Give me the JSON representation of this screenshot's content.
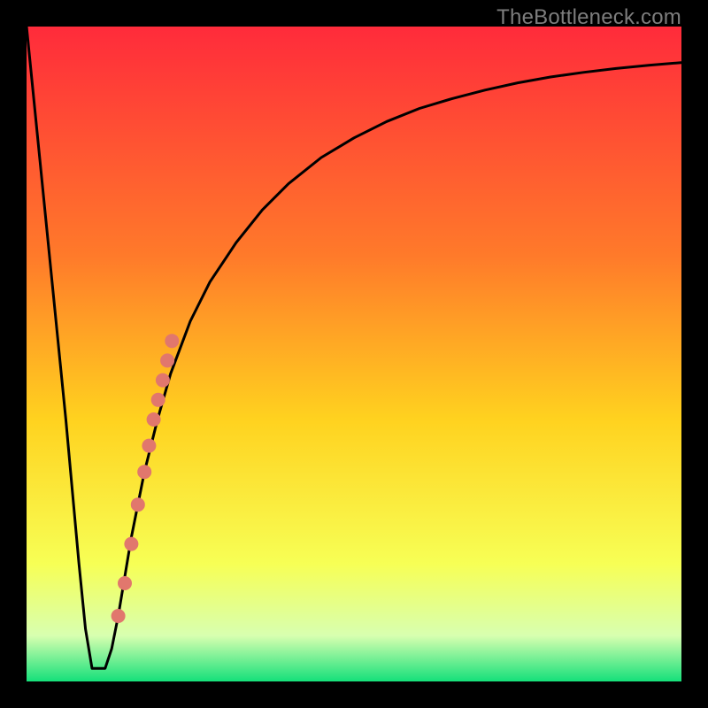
{
  "watermark": "TheBottleneck.com",
  "colors": {
    "frame": "#000000",
    "gradient_top": "#ff2b3b",
    "gradient_mid1": "#ff7a2a",
    "gradient_mid2": "#ffd21f",
    "gradient_mid3": "#f7ff55",
    "gradient_mid4": "#d8ffb0",
    "gradient_bottom": "#15e07a",
    "curve": "#000000",
    "marker": "#e1776d"
  },
  "chart_data": {
    "type": "line",
    "title": "",
    "xlabel": "",
    "ylabel": "",
    "xlim": [
      0,
      100
    ],
    "ylim": [
      0,
      100
    ],
    "grid": false,
    "legend": false,
    "annotations": [
      "TheBottleneck.com"
    ],
    "series": [
      {
        "name": "curve",
        "x": [
          0,
          2,
          4,
          6,
          8,
          9,
          10,
          11,
          12,
          13,
          14,
          16,
          18,
          20,
          22,
          25,
          28,
          32,
          36,
          40,
          45,
          50,
          55,
          60,
          65,
          70,
          75,
          80,
          85,
          90,
          95,
          100
        ],
        "y": [
          100,
          80,
          60,
          40,
          18,
          8,
          2,
          2,
          2,
          5,
          10,
          22,
          32,
          40,
          47,
          55,
          61,
          67,
          72,
          76,
          80,
          83,
          85.5,
          87.5,
          89,
          90.3,
          91.4,
          92.3,
          93,
          93.6,
          94.1,
          94.5
        ]
      }
    ],
    "markers": {
      "name": "highlight",
      "shape": "circle",
      "color": "#e1776d",
      "radius_px": 8,
      "points_xy": [
        [
          14,
          10
        ],
        [
          15,
          15
        ],
        [
          16,
          21
        ],
        [
          17,
          27
        ],
        [
          18,
          32
        ],
        [
          18.7,
          36
        ],
        [
          19.4,
          40
        ],
        [
          20.1,
          43
        ],
        [
          20.8,
          46
        ],
        [
          21.5,
          49
        ],
        [
          22.2,
          52
        ]
      ]
    }
  }
}
